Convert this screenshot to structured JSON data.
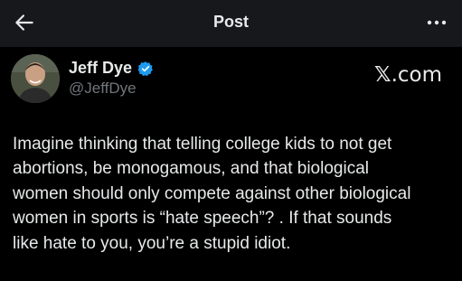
{
  "header": {
    "title": "Post",
    "back_icon": "arrow-left-icon",
    "more_icon": "more-dots-icon"
  },
  "author": {
    "name": "Jeff Dye",
    "handle": "@JeffDye",
    "verified": true,
    "verified_color": "#1d9bf0"
  },
  "source": {
    "label": ".com",
    "mark": "𝕏"
  },
  "tweet": {
    "lines": [
      "Imagine thinking that telling college kids to not get",
      "abortions, be monogamous, and that biological",
      "women should only compete against other biological",
      "women in sports is “hate speech”? . If that sounds",
      "like hate to you, you’re a stupid idiot."
    ]
  },
  "colors": {
    "background": "#000000",
    "header_background": "#16181c",
    "text": "#e7e9ea",
    "secondary_text": "#71767b"
  }
}
